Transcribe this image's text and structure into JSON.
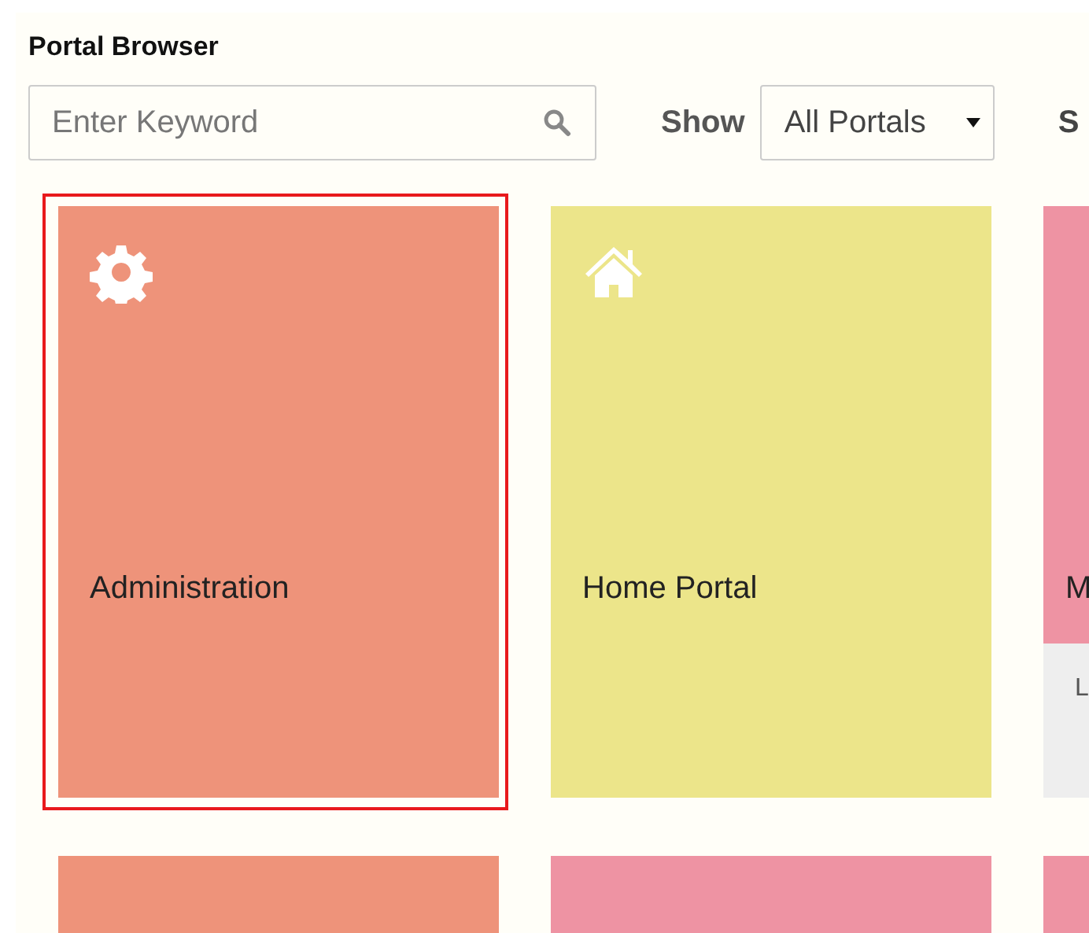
{
  "title": "Portal Browser",
  "search": {
    "placeholder": "Enter Keyword"
  },
  "show": {
    "label": "Show",
    "value": "All Portals"
  },
  "sort_label": "S",
  "portals": [
    {
      "kind": "gear",
      "label": "Administration",
      "color": "#ee937a",
      "selected": true
    },
    {
      "kind": "home",
      "label": "Home Portal",
      "color": "#ece58a",
      "selected": false
    },
    {
      "label": "M",
      "footer": "L",
      "color": "#ee93a3",
      "selected": false
    },
    {
      "color": "#ee937a",
      "selected": false
    },
    {
      "color": "#ee93a3",
      "selected": false
    },
    {
      "color": "#ee93a3",
      "selected": false
    }
  ]
}
